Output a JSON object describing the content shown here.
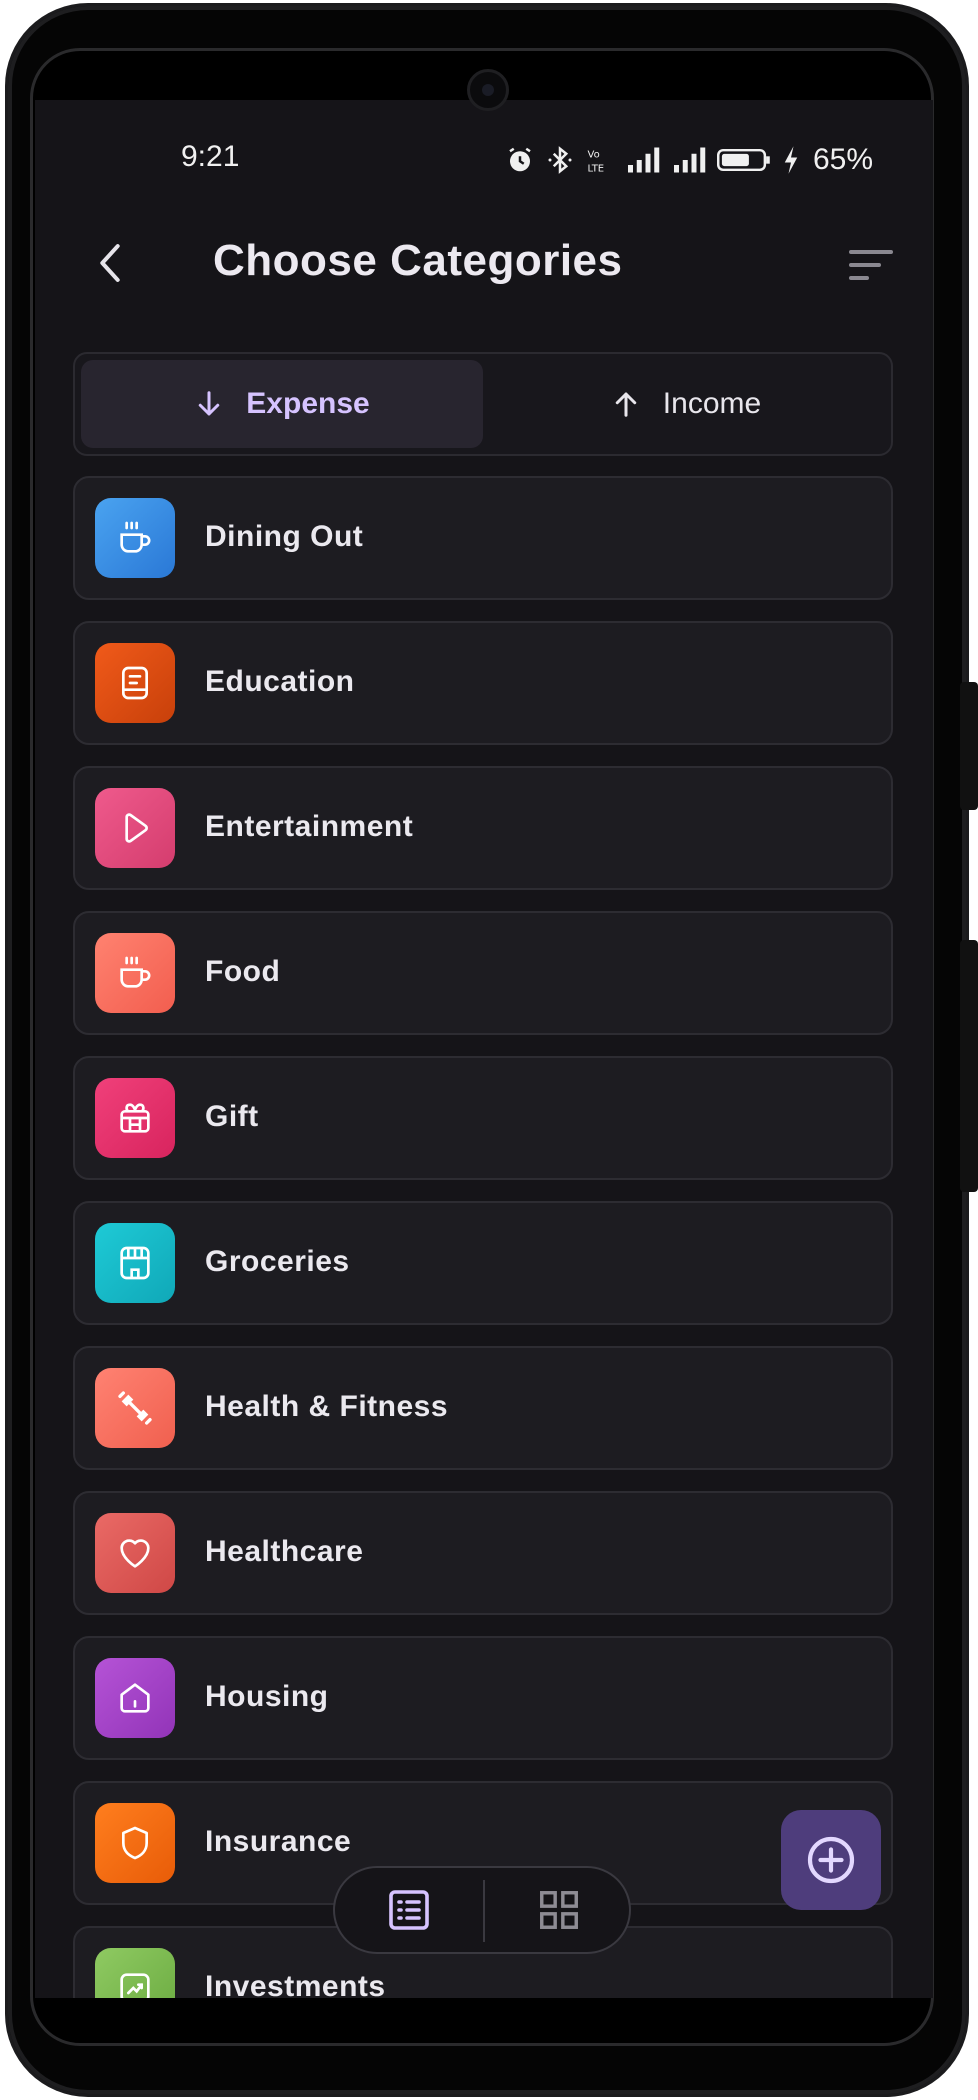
{
  "status_bar": {
    "time": "9:21",
    "battery": "65%"
  },
  "header": {
    "title": "Choose Categories"
  },
  "type_toggle": {
    "expense_label": "Expense",
    "income_label": "Income",
    "selected": "Expense"
  },
  "categories": [
    {
      "label": "Dining Out",
      "icon": "coffee-cup-icon",
      "color_from": "#4aa3f0",
      "color_to": "#2a78d6"
    },
    {
      "label": "Education",
      "icon": "notebook-icon",
      "color_from": "#f05a1a",
      "color_to": "#c8400a"
    },
    {
      "label": "Entertainment",
      "icon": "play-icon",
      "color_from": "#ef5a8c",
      "color_to": "#d43d6e"
    },
    {
      "label": "Food",
      "icon": "coffee-cup-icon",
      "color_from": "#ff8270",
      "color_to": "#f25e4f"
    },
    {
      "label": "Gift",
      "icon": "gift-box-icon",
      "color_from": "#f0407a",
      "color_to": "#d8245e"
    },
    {
      "label": "Groceries",
      "icon": "storefront-icon",
      "color_from": "#1ecad6",
      "color_to": "#10a8b8"
    },
    {
      "label": "Health & Fitness",
      "icon": "dumbbell-icon",
      "color_from": "#ff8272",
      "color_to": "#f0604f"
    },
    {
      "label": "Healthcare",
      "icon": "heart-icon",
      "color_from": "#ea6a66",
      "color_to": "#cf4846"
    },
    {
      "label": "Housing",
      "icon": "house-icon",
      "color_from": "#b553d6",
      "color_to": "#9234b8"
    },
    {
      "label": "Insurance",
      "icon": "shield-icon",
      "color_from": "#ff7e1e",
      "color_to": "#e85c08"
    },
    {
      "label": "Investments",
      "icon": "trend-chart-icon",
      "color_from": "#8fca62",
      "color_to": "#6aaa40"
    }
  ],
  "colors": {
    "background": "#151418",
    "accent": "#d6c3ff",
    "fab": "#4e3d7c"
  }
}
